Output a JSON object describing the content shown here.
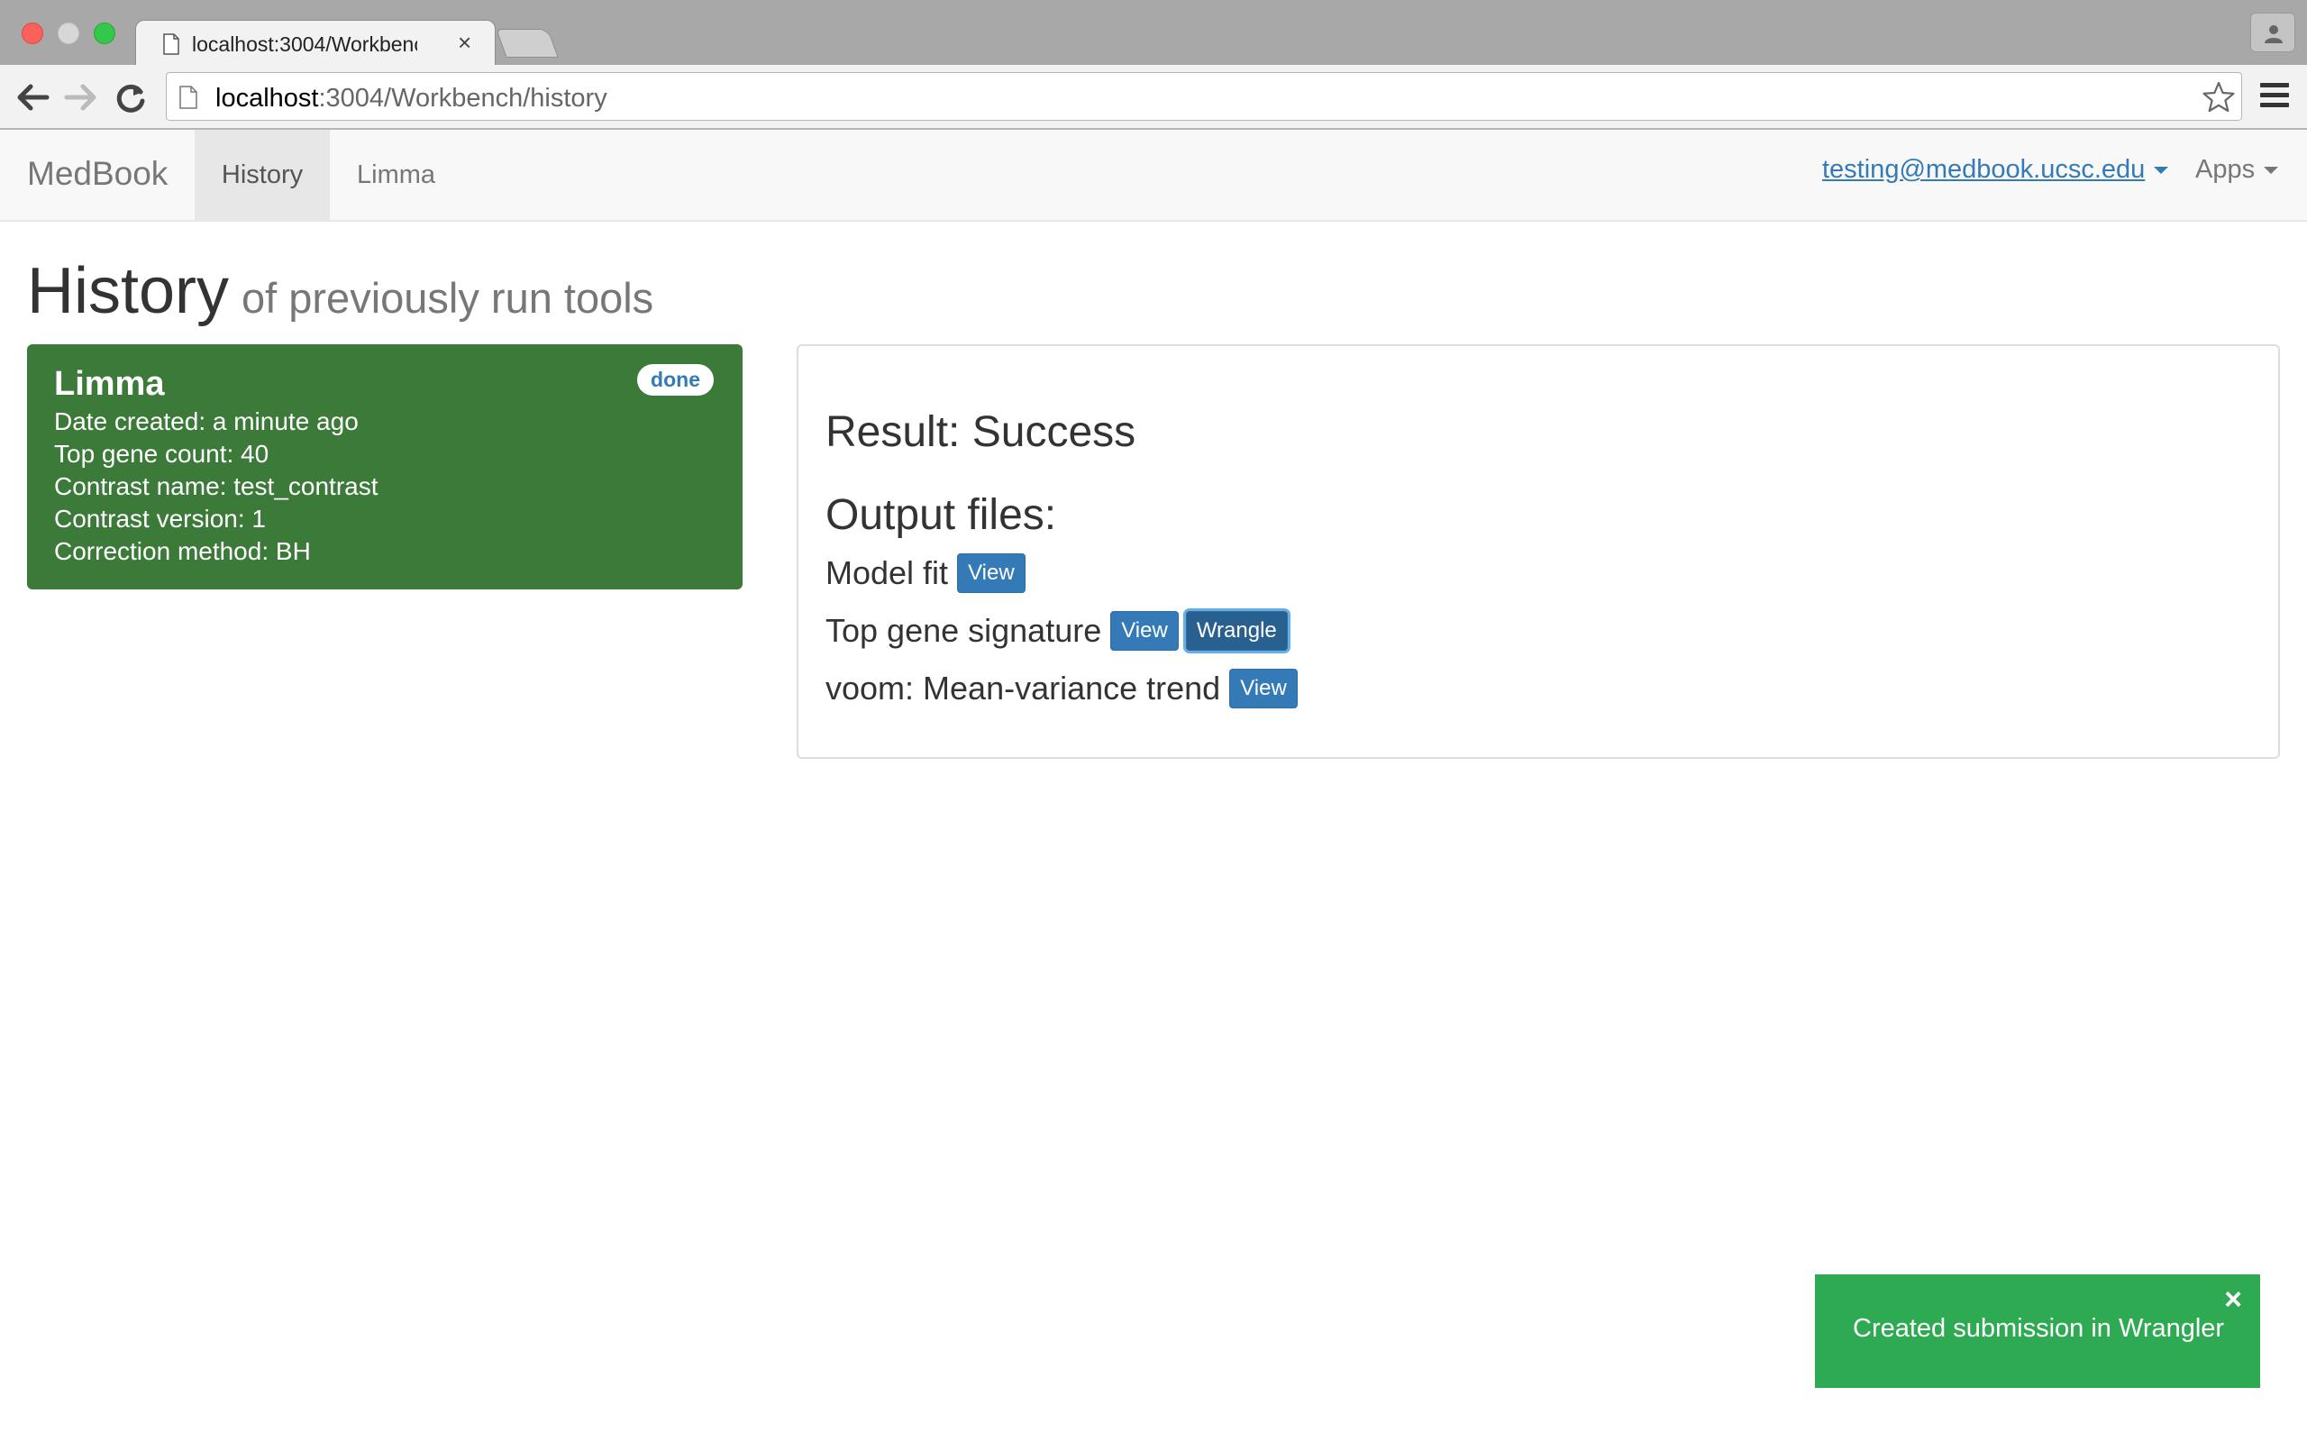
{
  "browser": {
    "tab_title": "localhost:3004/Workbench/history",
    "tab_close": "×",
    "url_host": "localhost",
    "url_path": ":3004/Workbench/history"
  },
  "navbar": {
    "brand": "MedBook",
    "links": [
      {
        "label": "History",
        "active": true
      },
      {
        "label": "Limma",
        "active": false
      }
    ],
    "user_email": "testing@medbook.ucsc.edu",
    "apps_label": "Apps"
  },
  "page": {
    "title": "History",
    "subtitle": "of previously run tools"
  },
  "job": {
    "name": "Limma",
    "status": "done",
    "details": [
      "Date created: a minute ago",
      "Top gene count: 40",
      "Contrast name: test_contrast",
      "Contrast version: 1",
      "Correction method: BH"
    ]
  },
  "result": {
    "heading": "Result: Success",
    "output_heading": "Output files:",
    "files": [
      {
        "name": "Model fit",
        "buttons": [
          "View"
        ]
      },
      {
        "name": "Top gene signature",
        "buttons": [
          "View",
          "Wrangle"
        ]
      },
      {
        "name": "voom: Mean-variance trend",
        "buttons": [
          "View"
        ]
      }
    ]
  },
  "toast": {
    "message": "Created submission in Wrangler",
    "close": "×"
  },
  "colors": {
    "job_card": "#3c7a3a",
    "primary_button": "#337ab7",
    "toast": "#2eaa52",
    "link": "#337ab7"
  },
  "icons": [
    "document-icon",
    "back-arrow-icon",
    "forward-arrow-icon",
    "reload-icon",
    "star-icon",
    "hamburger-menu-icon",
    "profile-icon",
    "caret-down-icon",
    "close-icon"
  ]
}
